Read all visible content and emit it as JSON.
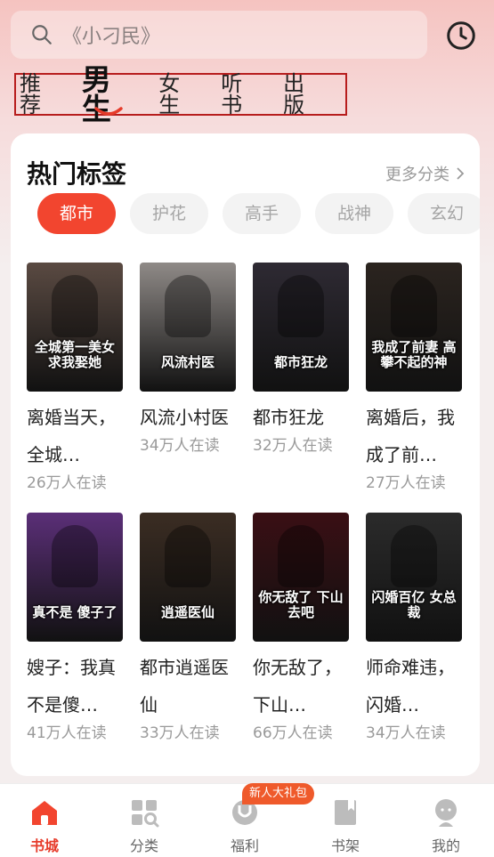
{
  "search": {
    "text": "《小刁民》"
  },
  "tabs": [
    {
      "label": "推荐"
    },
    {
      "label": "男生"
    },
    {
      "label": "女生"
    },
    {
      "label": "听书"
    },
    {
      "label": "出版"
    }
  ],
  "section": {
    "title": "热门标签",
    "more": "更多分类"
  },
  "chips": [
    {
      "label": "都市"
    },
    {
      "label": "护花"
    },
    {
      "label": "高手"
    },
    {
      "label": "战神"
    },
    {
      "label": "玄幻"
    }
  ],
  "books": [
    {
      "title": "离婚当天，全城…",
      "readers": "26万人在读",
      "cover_text": "全城第一美女 求我娶她",
      "cover_color": "#5a4a42"
    },
    {
      "title": "风流小村医",
      "readers": "34万人在读",
      "cover_text": "风流村医",
      "cover_color": "#8f8a87"
    },
    {
      "title": "都市狂龙",
      "readers": "32万人在读",
      "cover_text": "都市狂龙",
      "cover_color": "#2e2a33"
    },
    {
      "title": "离婚后，我成了前…",
      "readers": "27万人在读",
      "cover_text": "我成了前妻 高攀不起的神",
      "cover_color": "#2b241f"
    },
    {
      "title": "嫂子：我真不是傻…",
      "readers": "41万人在读",
      "cover_text": "真不是 傻子了",
      "cover_color": "#5b2f78"
    },
    {
      "title": "都市逍遥医仙",
      "readers": "33万人在读",
      "cover_text": "逍遥医仙",
      "cover_color": "#3b2d23"
    },
    {
      "title": "你无敌了，下山…",
      "readers": "66万人在读",
      "cover_text": "你无敌了 下山去吧",
      "cover_color": "#3a0f14"
    },
    {
      "title": "师命难违，闪婚…",
      "readers": "34万人在读",
      "cover_text": "闪婚百亿 女总裁",
      "cover_color": "#2b2b2b"
    }
  ],
  "bottom_nav": [
    {
      "label": "书城",
      "icon": "bookstore-icon"
    },
    {
      "label": "分类",
      "icon": "category-icon"
    },
    {
      "label": "福利",
      "icon": "welfare-icon"
    },
    {
      "label": "书架",
      "icon": "bookshelf-icon"
    },
    {
      "label": "我的",
      "icon": "profile-icon"
    }
  ],
  "gift_badge": "新人大礼包",
  "colors": {
    "accent": "#f2452f",
    "tab_border": "#b71d1d",
    "nav_active": "#e63b2a"
  }
}
